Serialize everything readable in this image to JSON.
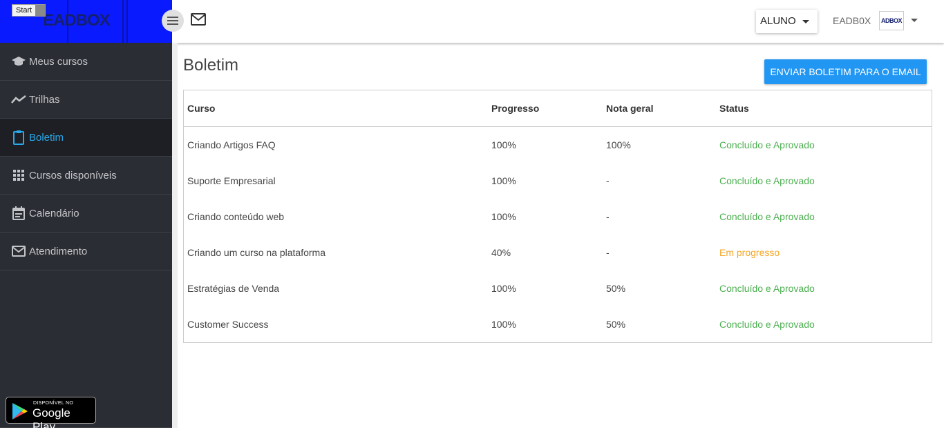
{
  "brand": {
    "logo_text": "EADBOX",
    "tooltip": "Start"
  },
  "sidebar": {
    "items": [
      {
        "label": "Meus cursos",
        "icon": "graduation-cap-icon"
      },
      {
        "label": "Trilhas",
        "icon": "trend-line-icon"
      },
      {
        "label": "Boletim",
        "icon": "clipboard-icon",
        "active": true
      },
      {
        "label": "Cursos disponíveis",
        "icon": "grid-icon"
      },
      {
        "label": "Calendário",
        "icon": "calendar-icon"
      },
      {
        "label": "Atendimento",
        "icon": "mail-icon"
      }
    ],
    "google_play": {
      "small": "DISPONÍVEL NO",
      "big": "Google Play"
    }
  },
  "topbar": {
    "role": "ALUNO",
    "user_name": "EADB0X",
    "avatar_text": "ADBOX"
  },
  "main": {
    "title": "Boletim",
    "send_button": "ENVIAR BOLETIM PARA O EMAIL",
    "table": {
      "headers": [
        "Curso",
        "Progresso",
        "Nota geral",
        "Status"
      ],
      "rows": [
        {
          "curso": "Criando Artigos FAQ",
          "progresso": "100%",
          "nota": "100%",
          "status": "Concluído e Aprovado"
        },
        {
          "curso": "Suporte Empresarial",
          "progresso": "100%",
          "nota": "-",
          "status": "Concluído e Aprovado"
        },
        {
          "curso": "Criando conteúdo web",
          "progresso": "100%",
          "nota": "-",
          "status": "Concluído e Aprovado"
        },
        {
          "curso": "Criando um curso na plataforma",
          "progresso": "40%",
          "nota": "-",
          "status": "Em progresso"
        },
        {
          "curso": "Estratégias de Venda",
          "progresso": "100%",
          "nota": "50%",
          "status": "Concluído e Aprovado"
        },
        {
          "curso": "Customer Success",
          "progresso": "100%",
          "nota": "50%",
          "status": "Concluído e Aprovado"
        }
      ]
    }
  },
  "colors": {
    "accent": "#2196f3",
    "success": "#4caf50",
    "warning": "#f5a623",
    "sidebar_bg": "#2b2d34",
    "active_text": "#29a8ea"
  }
}
